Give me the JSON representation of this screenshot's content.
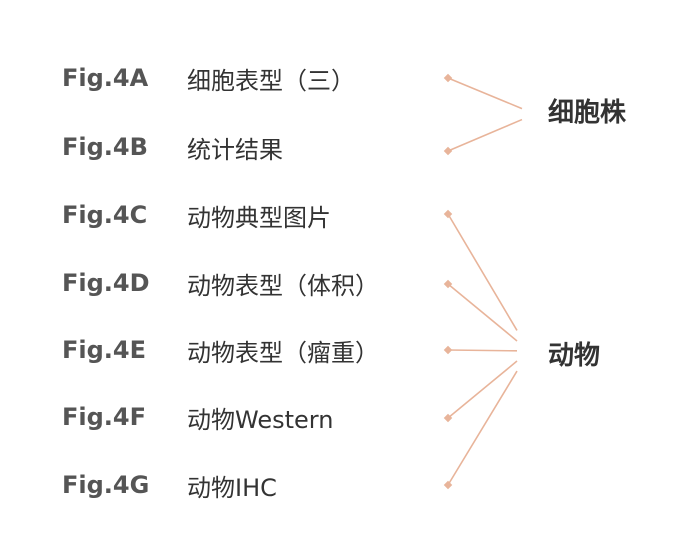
{
  "colors": {
    "connector": "#E8B49A",
    "fig_text": "#555555",
    "desc_text": "#333333"
  },
  "rows": [
    {
      "fig": "Fig.4A",
      "desc": "细胞表型（三）"
    },
    {
      "fig": "Fig.4B",
      "desc": "统计结果"
    },
    {
      "fig": "Fig.4C",
      "desc": "动物典型图片"
    },
    {
      "fig": "Fig.4D",
      "desc": "动物表型（体积）"
    },
    {
      "fig": "Fig.4E",
      "desc": "动物表型（瘤重）"
    },
    {
      "fig": "Fig.4F",
      "desc": "动物Western"
    },
    {
      "fig": "Fig.4G",
      "desc": "动物IHC"
    }
  ],
  "groups": [
    {
      "label": "细胞株",
      "members": [
        0,
        1
      ]
    },
    {
      "label": "动物",
      "members": [
        2,
        3,
        4,
        5,
        6
      ]
    }
  ]
}
